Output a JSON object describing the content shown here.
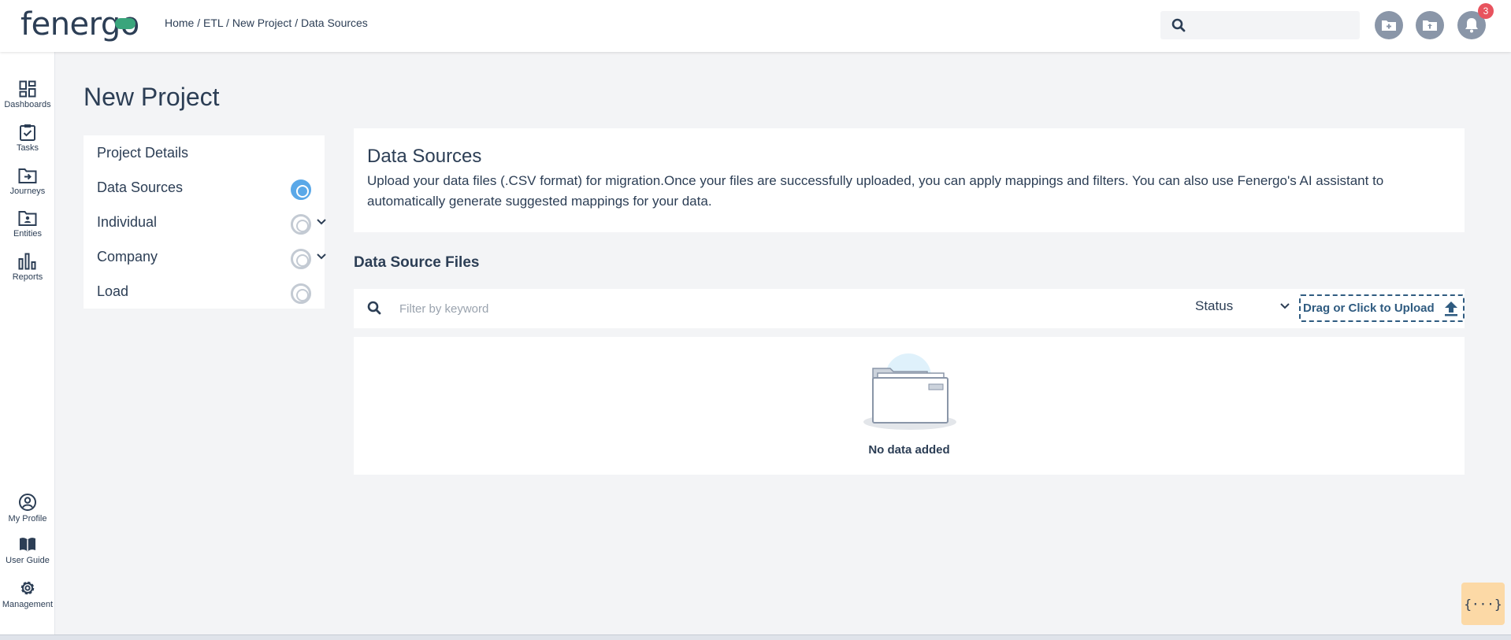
{
  "header": {
    "logo_text": "fenergo",
    "breadcrumb": "Home / ETL / New Project / Data Sources",
    "search_placeholder": "",
    "notification_count": "3"
  },
  "sidebar": {
    "top_items": [
      {
        "label": "Dashboards",
        "icon": "dashboard-icon"
      },
      {
        "label": "Tasks",
        "icon": "tasks-icon"
      },
      {
        "label": "Journeys",
        "icon": "journeys-icon"
      },
      {
        "label": "Entities",
        "icon": "entities-icon"
      },
      {
        "label": "Reports",
        "icon": "reports-icon"
      }
    ],
    "bottom_items": [
      {
        "label": "My Profile",
        "icon": "profile-icon"
      },
      {
        "label": "User Guide",
        "icon": "user-guide-icon"
      },
      {
        "label": "Management",
        "icon": "gear-icon"
      }
    ]
  },
  "page": {
    "title": "New Project"
  },
  "steps": [
    {
      "label": "Project Details"
    },
    {
      "label": "Data Sources"
    },
    {
      "label": "Individual"
    },
    {
      "label": "Company"
    },
    {
      "label": "Load"
    }
  ],
  "data_sources": {
    "title": "Data Sources",
    "description": "Upload your data files (.CSV format) for migration.Once your files are successfully uploaded, you can apply mappings and filters. You can also use Fenergo's AI assistant to automatically generate suggested mappings for your data."
  },
  "files": {
    "title": "Data Source Files",
    "filter_placeholder": "Filter by keyword",
    "status_label": "Status",
    "upload_label": "Drag or Click to Upload",
    "empty_message": "No data added"
  },
  "floating_button": {
    "label": "{···}"
  },
  "colors": {
    "primary_text": "#2c3e55",
    "accent_blue": "#5aa8e8",
    "badge_red": "#e8535e",
    "logo_green": "#3aa57c",
    "upload_border": "#2f5b80",
    "code_button_bg": "#fcd9a6"
  }
}
